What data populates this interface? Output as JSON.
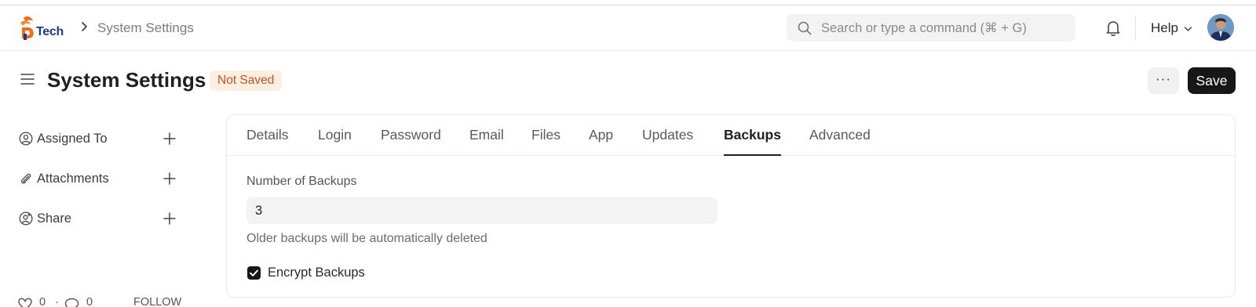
{
  "navbar": {
    "logo_text": "Tech",
    "breadcrumb_page": "System Settings",
    "search_placeholder": "Search or type a command (⌘ + G)",
    "help_label": "Help"
  },
  "header": {
    "title": "System Settings",
    "status_badge": "Not Saved",
    "more_label": "···",
    "save_label": "Save"
  },
  "sidebar": {
    "items": [
      {
        "label": "Assigned To",
        "icon": "user-circle-icon"
      },
      {
        "label": "Attachments",
        "icon": "paperclip-icon"
      },
      {
        "label": "Share",
        "icon": "share-user-icon"
      }
    ],
    "likes": "0",
    "comments": "0",
    "follow_label": "FOLLOW"
  },
  "tabs": [
    {
      "label": "Details"
    },
    {
      "label": "Login"
    },
    {
      "label": "Password"
    },
    {
      "label": "Email"
    },
    {
      "label": "Files"
    },
    {
      "label": "App"
    },
    {
      "label": "Updates"
    },
    {
      "label": "Backups",
      "active": true
    },
    {
      "label": "Advanced"
    }
  ],
  "backups": {
    "number_label": "Number of Backups",
    "number_value": "3",
    "number_description": "Older backups will be automatically deleted",
    "encrypt_label": "Encrypt Backups",
    "encrypt_checked": true
  },
  "colors": {
    "accent_dark": "#171717",
    "badge_bg": "#fdeee2",
    "badge_text": "#c0532a",
    "logo_orange": "#f26b1d",
    "logo_blue": "#1f3a8a"
  }
}
